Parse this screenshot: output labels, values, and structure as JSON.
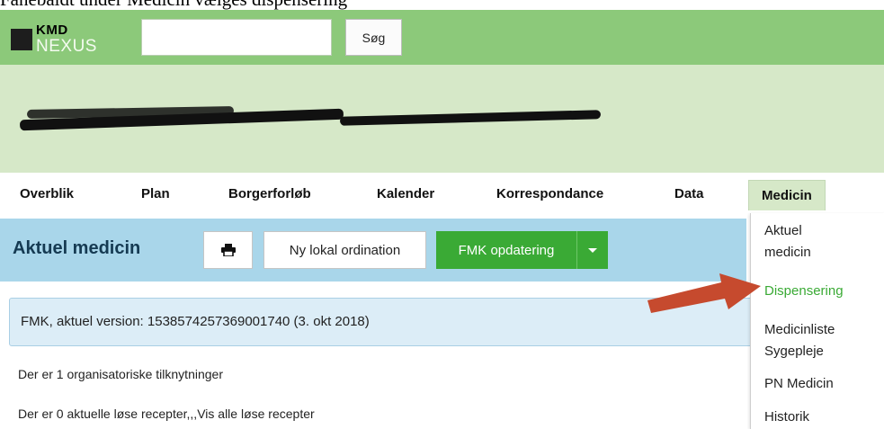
{
  "caption": "Fanebaldt under Medicin vælges dispensering",
  "topbar": {
    "logo_brand": "KMD",
    "logo_product": "NEXUS",
    "search_placeholder": "",
    "search_button_label": "Søg"
  },
  "patient": {
    "redacted": true
  },
  "nav": {
    "tabs": [
      {
        "label": "Overblik"
      },
      {
        "label": "Plan"
      },
      {
        "label": "Borgerforløb"
      },
      {
        "label": "Kalender"
      },
      {
        "label": "Korrespondance"
      },
      {
        "label": "Data"
      },
      {
        "label": "Medicin",
        "active": true
      }
    ]
  },
  "subheader": {
    "title": "Aktuel medicin",
    "print_icon": "printer-icon",
    "new_local_label": "Ny lokal ordination",
    "fmk_update_label": "FMK opdatering"
  },
  "info": {
    "fmk_version": "FMK, aktuel version: 1538574257369001740 (3. okt 2018)"
  },
  "lines": {
    "org_links": "Der er 1 organisatoriske tilknytninger",
    "loose_prescriptions": "Der er 0 aktuelle løse recepter,,,Vis alle løse recepter"
  },
  "dropdown": {
    "items": [
      {
        "label": "Aktuel\nmedicin"
      },
      {
        "label": "Dispensering",
        "selected": true
      },
      {
        "label": "Medicinliste\nSygepleje"
      },
      {
        "label": "PN Medicin"
      },
      {
        "label": "Historik"
      }
    ]
  },
  "colors": {
    "topbar": "#8cc97a",
    "patient_band": "#d6e8c8",
    "subheader": "#a9d6ea",
    "fmk_button": "#3aaa35",
    "arrow": "#c64a2e",
    "selected_item": "#3aaa35"
  }
}
